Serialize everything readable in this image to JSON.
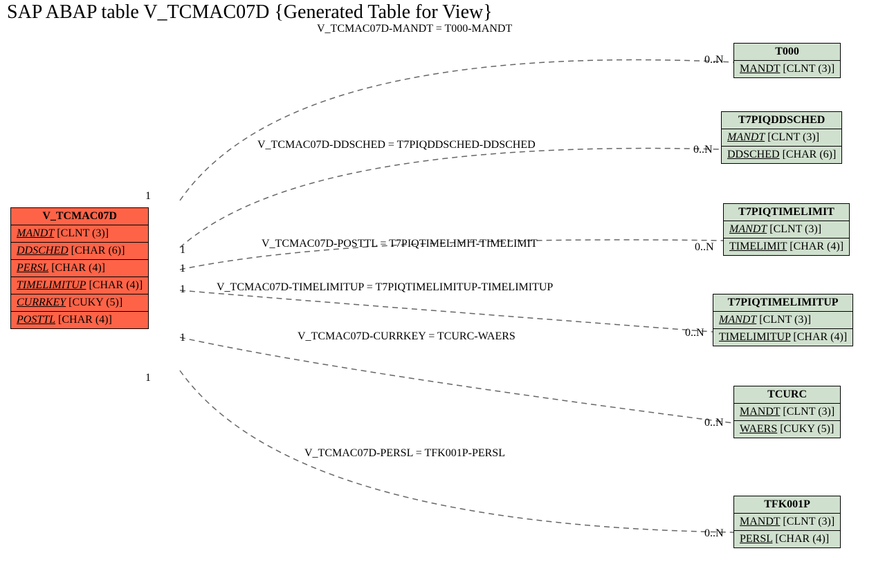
{
  "title": "SAP ABAP table V_TCMAC07D {Generated Table for View}",
  "source": {
    "name": "V_TCMAC07D",
    "fields": [
      {
        "name": "MANDT",
        "type": "CLNT (3)",
        "style": "ital"
      },
      {
        "name": "DDSCHED",
        "type": "CHAR (6)",
        "style": "ital"
      },
      {
        "name": "PERSL",
        "type": "CHAR (4)",
        "style": "ital"
      },
      {
        "name": "TIMELIMITUP",
        "type": "CHAR (4)",
        "style": "ital"
      },
      {
        "name": "CURRKEY",
        "type": "CUKY (5)",
        "style": "ital"
      },
      {
        "name": "POSTTL",
        "type": "CHAR (4)",
        "style": "ital"
      }
    ]
  },
  "targets": [
    {
      "name": "T000",
      "fields": [
        {
          "name": "MANDT",
          "type": "CLNT (3)",
          "style": "ul"
        }
      ]
    },
    {
      "name": "T7PIQDDSCHED",
      "fields": [
        {
          "name": "MANDT",
          "type": "CLNT (3)",
          "style": "ital"
        },
        {
          "name": "DDSCHED",
          "type": "CHAR (6)",
          "style": "ul"
        }
      ]
    },
    {
      "name": "T7PIQTIMELIMIT",
      "fields": [
        {
          "name": "MANDT",
          "type": "CLNT (3)",
          "style": "ital"
        },
        {
          "name": "TIMELIMIT",
          "type": "CHAR (4)",
          "style": "ul"
        }
      ]
    },
    {
      "name": "T7PIQTIMELIMITUP",
      "fields": [
        {
          "name": "MANDT",
          "type": "CLNT (3)",
          "style": "ital"
        },
        {
          "name": "TIMELIMITUP",
          "type": "CHAR (4)",
          "style": "ul"
        }
      ]
    },
    {
      "name": "TCURC",
      "fields": [
        {
          "name": "MANDT",
          "type": "CLNT (3)",
          "style": "ul"
        },
        {
          "name": "WAERS",
          "type": "CUKY (5)",
          "style": "ul"
        }
      ]
    },
    {
      "name": "TFK001P",
      "fields": [
        {
          "name": "MANDT",
          "type": "CLNT (3)",
          "style": "ul"
        },
        {
          "name": "PERSL",
          "type": "CHAR (4)",
          "style": "ul"
        }
      ]
    }
  ],
  "relations": [
    {
      "label": "V_TCMAC07D-MANDT = T000-MANDT",
      "card": "0..N"
    },
    {
      "label": "V_TCMAC07D-DDSCHED = T7PIQDDSCHED-DDSCHED",
      "card": "0..N"
    },
    {
      "label": "V_TCMAC07D-POSTTL = T7PIQTIMELIMIT-TIMELIMIT",
      "card": "0..N"
    },
    {
      "label": "V_TCMAC07D-TIMELIMITUP = T7PIQTIMELIMITUP-TIMELIMITUP",
      "card": "0..N"
    },
    {
      "label": "V_TCMAC07D-CURRKEY = TCURC-WAERS",
      "card": "0..N"
    },
    {
      "label": "V_TCMAC07D-PERSL = TFK001P-PERSL",
      "card": "0..N"
    }
  ],
  "srccard": "1"
}
